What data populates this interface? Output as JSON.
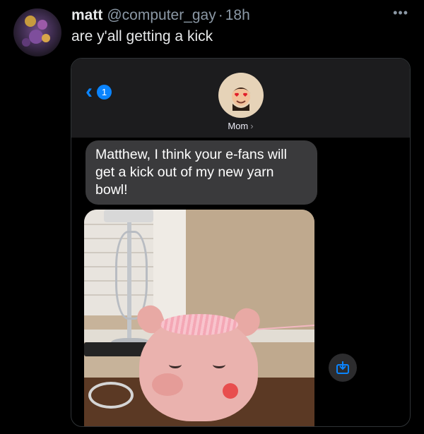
{
  "tweet": {
    "author": {
      "display_name": "matt",
      "handle": "@computer_gay",
      "avatar_icon": "profile-photo-avatar"
    },
    "separator": "·",
    "time": "18h",
    "text": "are y'all getting a kick",
    "more_icon": "more-options-icon"
  },
  "message_screenshot": {
    "back_icon": "chevron-left-icon",
    "unread_count": "1",
    "contact": {
      "name": "Mom",
      "avatar_icon": "memoji-avatar"
    },
    "message": "Matthew, I think your e-fans will get a kick out of my new yarn bowl!",
    "photo_icon": "photo-pig-yarn-bowl",
    "save_icon": "save-to-device-icon"
  },
  "colors": {
    "background": "#000000",
    "text_primary": "#e7e9ea",
    "text_secondary": "#8b98a5",
    "imessage_blue": "#0a84ff",
    "bubble_gray": "#3a3a3c"
  }
}
